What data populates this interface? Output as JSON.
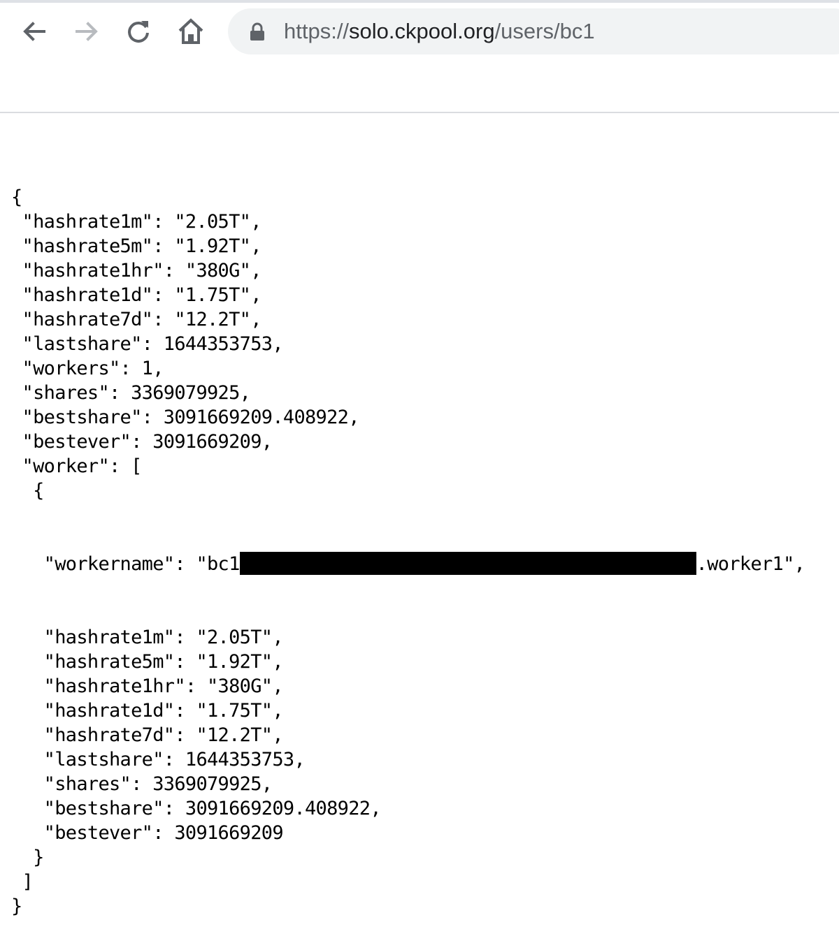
{
  "browser": {
    "url_scheme": "https://",
    "url_host": "solo.ckpool.org",
    "url_path": "/users/bc1"
  },
  "json_lines": [
    "{",
    " \"hashrate1m\": \"2.05T\",",
    " \"hashrate5m\": \"1.92T\",",
    " \"hashrate1hr\": \"380G\",",
    " \"hashrate1d\": \"1.75T\",",
    " \"hashrate7d\": \"12.2T\",",
    " \"lastshare\": 1644353753,",
    " \"workers\": 1,",
    " \"shares\": 3369079925,",
    " \"bestshare\": 3091669209.408922,",
    " \"bestever\": 3091669209,",
    " \"worker\": [",
    "  {"
  ],
  "workername_line": {
    "prefix": "   \"workername\": \"bc1",
    "suffix": ".worker1\","
  },
  "json_lines_after": [
    "   \"hashrate1m\": \"2.05T\",",
    "   \"hashrate5m\": \"1.92T\",",
    "   \"hashrate1hr\": \"380G\",",
    "   \"hashrate1d\": \"1.75T\",",
    "   \"hashrate7d\": \"12.2T\",",
    "   \"lastshare\": 1644353753,",
    "   \"shares\": 3369079925,",
    "   \"bestshare\": 3091669209.408922,",
    "   \"bestever\": 3091669209",
    "  }",
    " ]",
    "}"
  ],
  "icons": [
    "back-arrow-icon",
    "forward-arrow-icon",
    "reload-icon",
    "home-icon",
    "lock-icon"
  ]
}
